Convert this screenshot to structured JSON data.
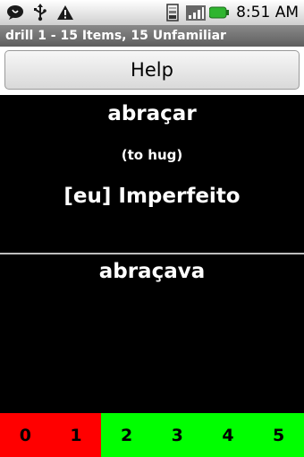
{
  "status_bar": {
    "time": "8:51 AM",
    "left_icons": [
      "chat-bubble-icon",
      "usb-icon",
      "warning-icon"
    ],
    "right_icons": [
      "wifi-icon",
      "signal-icon",
      "battery-icon"
    ],
    "battery_color": "#2fb52f"
  },
  "title_bar": {
    "text": "drill 1 - 15 Items, 15 Unfamiliar"
  },
  "help_button": {
    "label": "Help"
  },
  "prompt": {
    "verb": "abraçar",
    "translation": "(to hug)",
    "tense": "[eu] Imperfeito"
  },
  "answer": {
    "text": "abraçava"
  },
  "rating": {
    "buttons": [
      {
        "label": "0",
        "color": "#ff0000"
      },
      {
        "label": "1",
        "color": "#ff0000"
      },
      {
        "label": "2",
        "color": "#00ff00"
      },
      {
        "label": "3",
        "color": "#00ff00"
      },
      {
        "label": "4",
        "color": "#00ff00"
      },
      {
        "label": "5",
        "color": "#00ff00"
      }
    ]
  }
}
